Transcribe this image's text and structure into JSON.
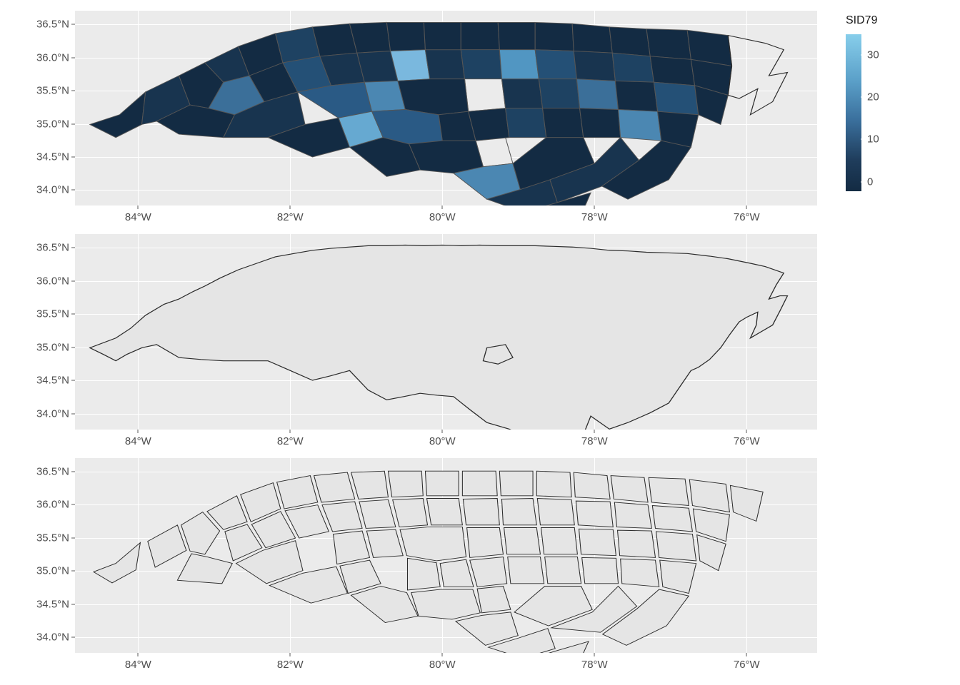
{
  "legend": {
    "title": "SID79",
    "ticks": [
      "30",
      "20",
      "10",
      "0"
    ],
    "tick_positions_pct": [
      13,
      40,
      67,
      94
    ],
    "min": 0,
    "max": 37
  },
  "axes": {
    "y_ticks": [
      "36.5°N",
      "36.0°N",
      "35.5°N",
      "35.0°N",
      "34.5°N",
      "34.0°N"
    ],
    "y_positions_pct": [
      7,
      24,
      41,
      58,
      75,
      92
    ],
    "x_ticks": [
      "84°W",
      "82°W",
      "80°W",
      "78°W",
      "76°W"
    ],
    "x_positions_pct": [
      8.5,
      29,
      49.5,
      70,
      90.5
    ]
  },
  "chart_data": [
    {
      "type": "map",
      "description": "Choropleth map of North Carolina counties colored by SID79",
      "region": "North Carolina, USA",
      "projection": "geographic",
      "xlim_deg": [
        -84.5,
        -75.3
      ],
      "ylim_deg": [
        33.7,
        36.7
      ],
      "fill_variable": "SID79",
      "fill_scale": {
        "low": "#132B43",
        "high": "#87CEEB",
        "range": [
          0,
          37
        ]
      },
      "n_polygons": 100,
      "notes": "County polygons with dark-to-light blue fill; two interior grey (NA) polygons near center"
    },
    {
      "type": "map",
      "description": "Outline of unioned North Carolina state boundary",
      "region": "North Carolina, USA",
      "xlim_deg": [
        -84.5,
        -75.3
      ],
      "ylim_deg": [
        33.7,
        36.7
      ],
      "fill": "#E5E5E5",
      "stroke": "#333333",
      "n_polygons": 1,
      "notes": "Single dissolved state outline; interior hole visible near Fort Bragg/Cumberland area"
    },
    {
      "type": "map",
      "description": "Simplified county geometries (convex-hull-like) of North Carolina",
      "region": "North Carolina, USA",
      "xlim_deg": [
        -84.5,
        -75.3
      ],
      "ylim_deg": [
        33.7,
        36.7
      ],
      "fill": "#E5E5E5",
      "stroke": "#333333",
      "n_polygons": 100,
      "notes": "Angular simplified polygons with gaps between them"
    }
  ]
}
